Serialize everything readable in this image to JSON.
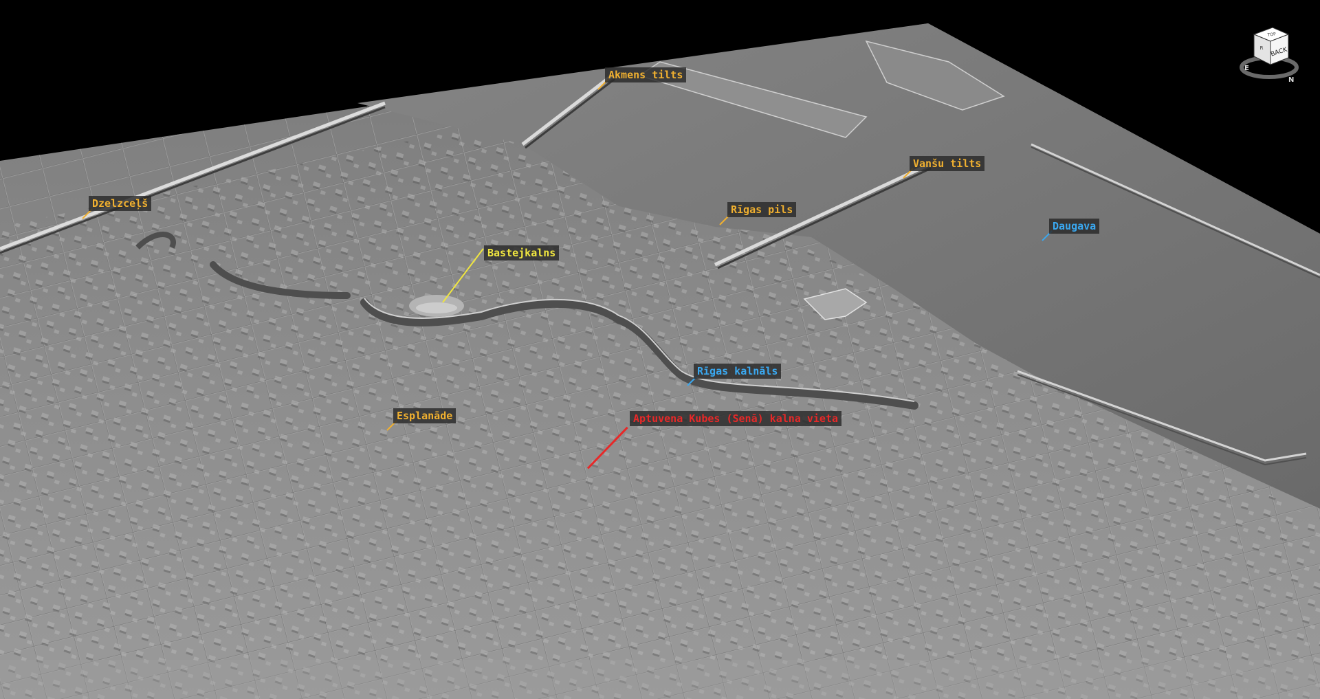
{
  "colors": {
    "sky": "#000000",
    "terrain": "#8a8a8a",
    "river": "#7e7e7e",
    "label_orange": "#f0b030",
    "label_yellow": "#f0e640",
    "label_blue": "#3aa8f0",
    "label_red": "#e82828"
  },
  "labels": {
    "akmens_tilts": {
      "text": "Akmens tilts",
      "color": "#f0b030"
    },
    "vansu_tilts": {
      "text": "Vanšu tilts",
      "color": "#f0b030"
    },
    "dzelzcels": {
      "text": "Dzelzceļš",
      "color": "#f0b030"
    },
    "rigas_pils": {
      "text": "Rīgas pils",
      "color": "#f0b030"
    },
    "daugava": {
      "text": "Daugava",
      "color": "#3aa8f0"
    },
    "bastejkalns": {
      "text": "Bastejkalns",
      "color": "#f0e640"
    },
    "rigas_kalnals": {
      "text": "Rīgas kalnāls",
      "color": "#3aa8f0"
    },
    "esplanade": {
      "text": "Esplanāde",
      "color": "#f0b030"
    },
    "kubes_kalns": {
      "text": "Aptuvena Kubes (Senā) kalna vieta",
      "color": "#e82828"
    }
  },
  "nav_cube": {
    "front_face": "BACK",
    "top_face": "TOP",
    "side_face": "R",
    "compass_north": "N",
    "compass_east": "E",
    "icon": "navigation-cube-icon"
  }
}
